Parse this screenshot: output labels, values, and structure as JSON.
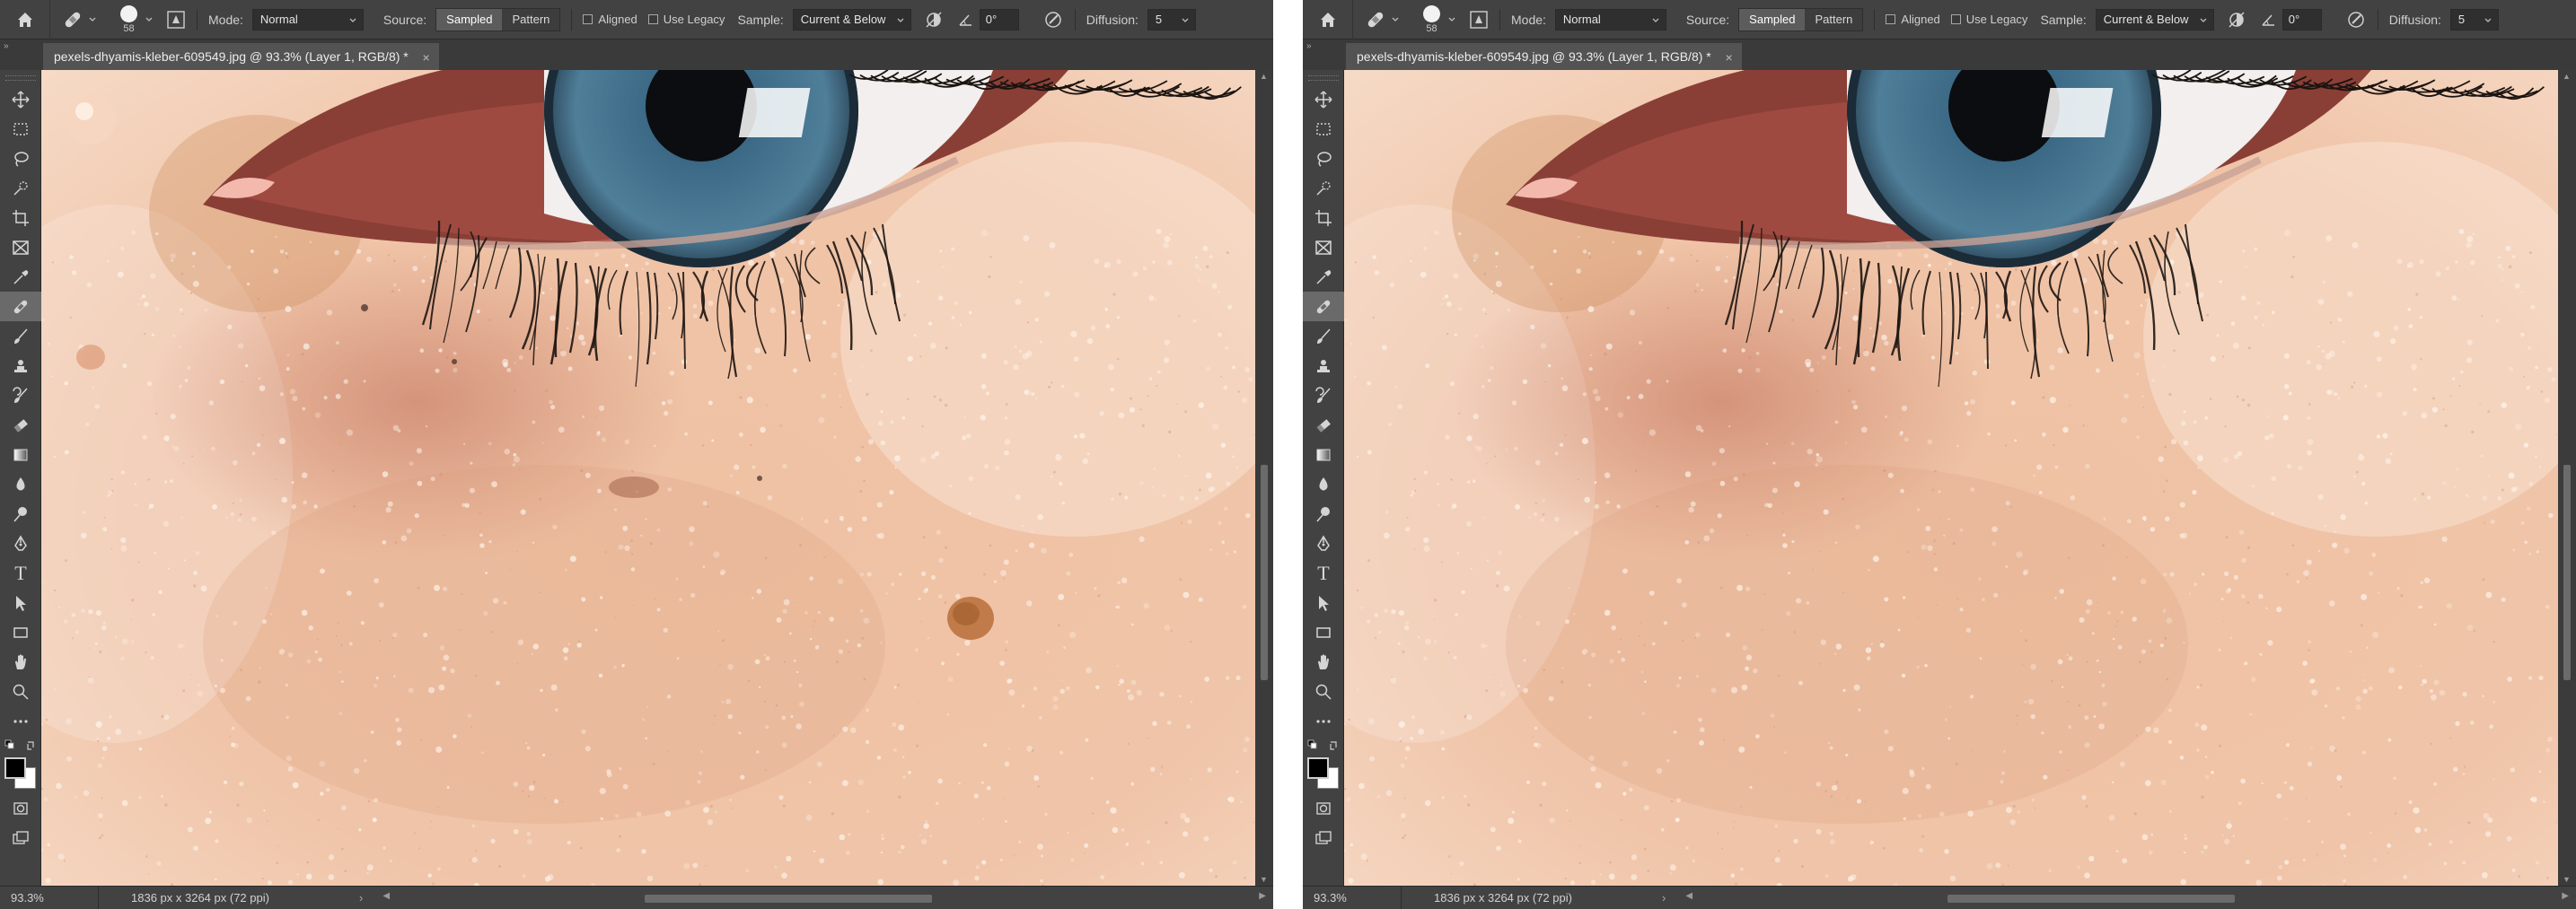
{
  "panels": [
    {
      "id": "before",
      "options_bar": {
        "brush_size": "58",
        "mode_label": "Mode:",
        "mode_value": "Normal",
        "source_label": "Source:",
        "source_sampled": "Sampled",
        "source_pattern": "Pattern",
        "aligned_label": "Aligned",
        "use_legacy_label": "Use Legacy",
        "sample_label": "Sample:",
        "sample_value": "Current & Below",
        "angle_value": "0°",
        "diffusion_label": "Diffusion:",
        "diffusion_value": "5"
      },
      "document_tab": {
        "title": "pexels-dhyamis-kleber-609549.jpg @ 93.3% (Layer 1, RGB/8) *",
        "close": "×"
      },
      "status": {
        "zoom": "93.3%",
        "doc_info": "1836 px x 3264 px (72 ppi)",
        "arrow": "›"
      }
    },
    {
      "id": "after",
      "options_bar": {
        "brush_size": "58",
        "mode_label": "Mode:",
        "mode_value": "Normal",
        "source_label": "Source:",
        "source_sampled": "Sampled",
        "source_pattern": "Pattern",
        "aligned_label": "Aligned",
        "use_legacy_label": "Use Legacy",
        "sample_label": "Sample:",
        "sample_value": "Current & Below",
        "angle_value": "0°",
        "diffusion_label": "Diffusion:",
        "diffusion_value": "5"
      },
      "document_tab": {
        "title": "pexels-dhyamis-kleber-609549.jpg @ 93.3% (Layer 1, RGB/8) *",
        "close": "×"
      },
      "status": {
        "zoom": "93.3%",
        "doc_info": "1836 px x 3264 px (72 ppi)",
        "arrow": "›"
      }
    }
  ],
  "toolbar": {
    "collapse_arrows": "»",
    "tools": [
      {
        "name": "move-tool",
        "icon": "move-icon"
      },
      {
        "name": "marquee-tool",
        "icon": "marquee-icon"
      },
      {
        "name": "lasso-tool",
        "icon": "lasso-icon"
      },
      {
        "name": "quick-selection-tool",
        "icon": "quick-selection-icon"
      },
      {
        "name": "crop-tool",
        "icon": "crop-icon"
      },
      {
        "name": "frame-tool",
        "icon": "frame-icon"
      },
      {
        "name": "eyedropper-tool",
        "icon": "eyedropper-icon"
      },
      {
        "name": "spot-healing-brush-tool",
        "icon": "bandage-icon",
        "active": true
      },
      {
        "name": "brush-tool",
        "icon": "brush-icon"
      },
      {
        "name": "clone-stamp-tool",
        "icon": "stamp-icon"
      },
      {
        "name": "history-brush-tool",
        "icon": "history-brush-icon"
      },
      {
        "name": "eraser-tool",
        "icon": "eraser-icon"
      },
      {
        "name": "gradient-tool",
        "icon": "gradient-icon"
      },
      {
        "name": "blur-tool",
        "icon": "drop-icon"
      },
      {
        "name": "dodge-tool",
        "icon": "dodge-icon"
      },
      {
        "name": "pen-tool",
        "icon": "pen-icon"
      },
      {
        "name": "type-tool",
        "icon": "type-icon",
        "glyph": "T"
      },
      {
        "name": "path-selection-tool",
        "icon": "arrow-cursor-icon"
      },
      {
        "name": "rectangle-tool",
        "icon": "rectangle-icon"
      },
      {
        "name": "hand-tool",
        "icon": "hand-icon"
      },
      {
        "name": "zoom-tool",
        "icon": "zoom-icon"
      },
      {
        "name": "edit-toolbar",
        "icon": "more-icon"
      }
    ],
    "foreground_color": "#000000",
    "background_color": "#ffffff"
  },
  "colors": {
    "panel_bg": "#535353",
    "bar_bg": "#424242",
    "active_tool": "#6a6a6a",
    "skin_base": "#eab99e",
    "iris": "#3f6b86"
  }
}
